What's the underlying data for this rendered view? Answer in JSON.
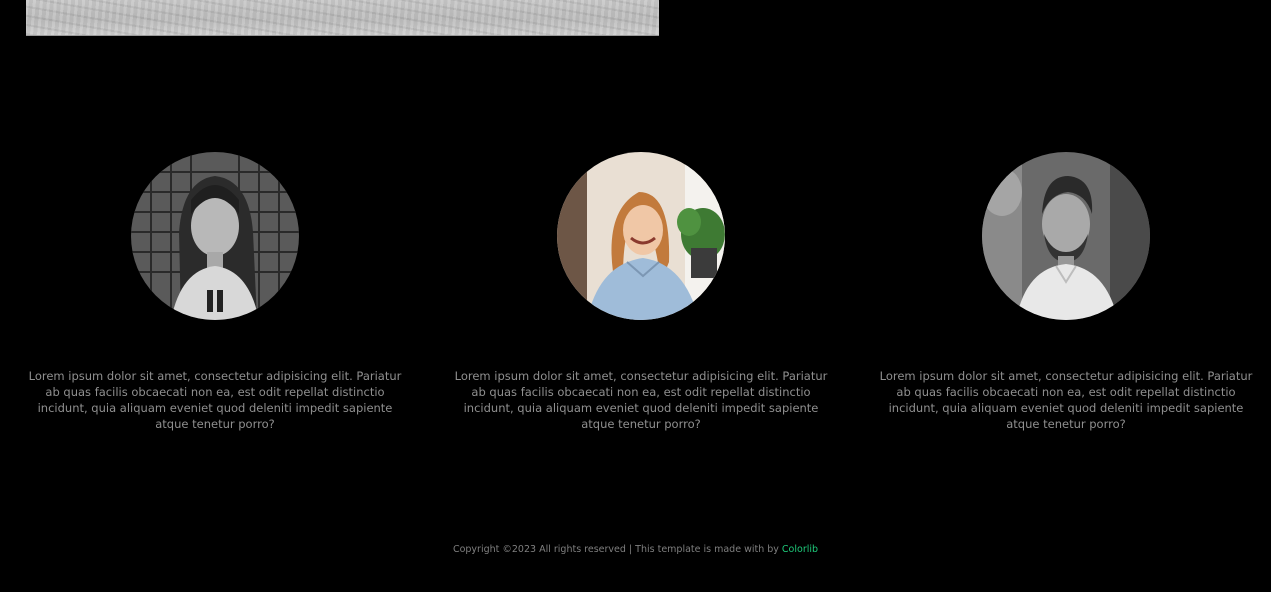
{
  "team": {
    "members": [
      {
        "bio": "Lorem ipsum dolor sit amet, consectetur adipisicing elit. Pariatur ab quas facilis obcaecati non ea, est odit repellat distinctio incidunt, quia aliquam eveniet quod deleniti impedit sapiente atque tenetur porro?"
      },
      {
        "bio": "Lorem ipsum dolor sit amet, consectetur adipisicing elit. Pariatur ab quas facilis obcaecati non ea, est odit repellat distinctio incidunt, quia aliquam eveniet quod deleniti impedit sapiente atque tenetur porro?"
      },
      {
        "bio": "Lorem ipsum dolor sit amet, consectetur adipisicing elit. Pariatur ab quas facilis obcaecati non ea, est odit repellat distinctio incidunt, quia aliquam eveniet quod deleniti impedit sapiente atque tenetur porro?"
      }
    ]
  },
  "footer": {
    "copyright_text": "Copyright ©2023 All rights reserved | This template is made with by ",
    "link_label": "Colorlib",
    "link_color": "#1ec97a"
  },
  "colors": {
    "background": "#000000",
    "text_muted": "#8f8f8f"
  }
}
